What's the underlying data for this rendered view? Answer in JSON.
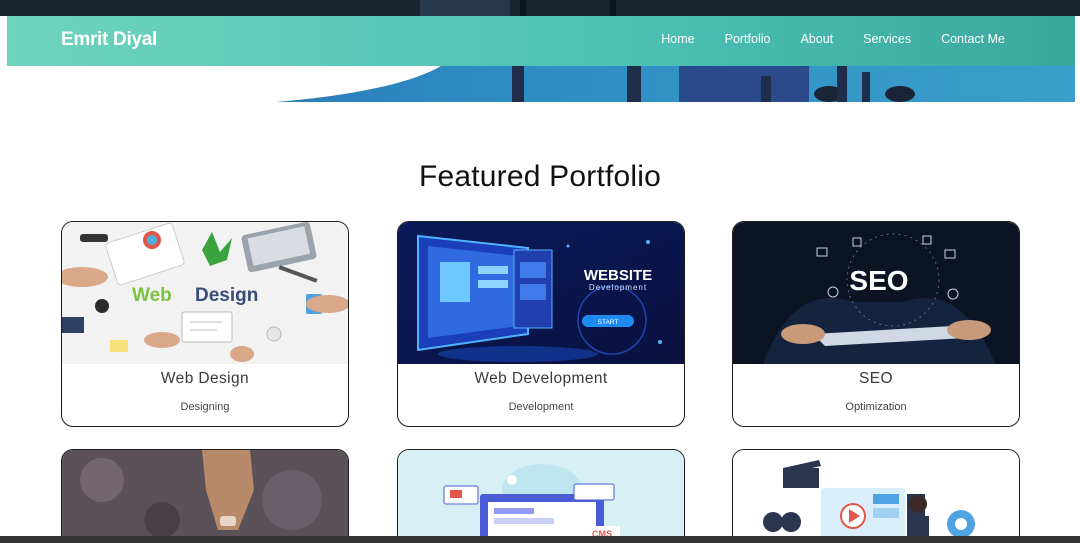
{
  "brand": "Emrit Diyal",
  "nav": {
    "items": [
      {
        "label": "Home"
      },
      {
        "label": "Portfolio"
      },
      {
        "label": "About"
      },
      {
        "label": "Services"
      },
      {
        "label": "Contact Me"
      }
    ]
  },
  "portfolio": {
    "heading": "Featured Portfolio",
    "cards": [
      {
        "title": "Web Design",
        "subtitle": "Designing",
        "image_text": "Web Design"
      },
      {
        "title": "Web Development",
        "subtitle": "Development",
        "image_text": "WEBSITE",
        "image_subtext": "Development",
        "image_button": "START"
      },
      {
        "title": "SEO",
        "subtitle": "Optimization",
        "image_text": "SEO"
      }
    ],
    "second_row": [
      {
        "image": "hand-photo"
      },
      {
        "image": "cms-illustration",
        "image_text": "CMS"
      },
      {
        "image": "video-editing-illustration"
      }
    ]
  },
  "colors": {
    "nav_gradient_start": "#6ed3bd",
    "nav_gradient_end": "#3aa79c"
  }
}
